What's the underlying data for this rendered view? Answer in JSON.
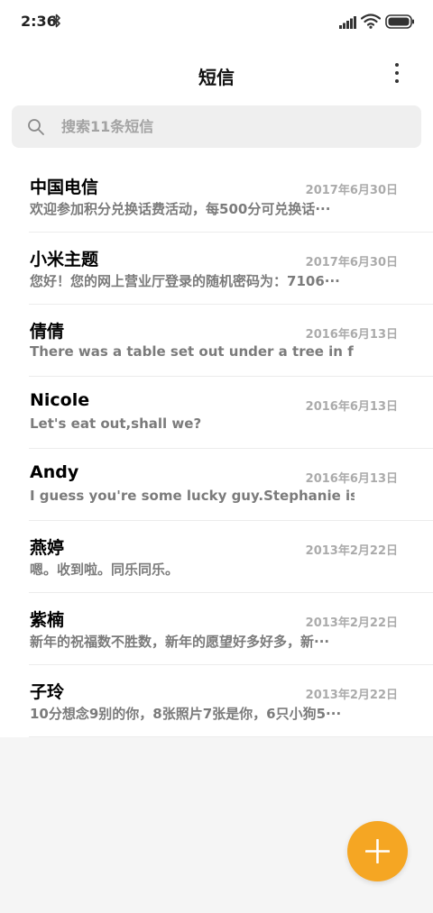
{
  "status_bar": {
    "time": "2:36",
    "icons": [
      "bluetooth-icon",
      "signal-icon",
      "wifi-icon",
      "battery-icon"
    ]
  },
  "header": {
    "title": "短信",
    "more_icon": "more-vertical-icon"
  },
  "search": {
    "placeholder": "搜索11条短信",
    "icon": "search-icon"
  },
  "conversations": [
    {
      "name": "中国电信",
      "date": "2017年6月30日",
      "preview": "欢迎参加积分兑换话费活动，每500分可兑换话···"
    },
    {
      "name": "小米主题",
      "date": "2017年6月30日",
      "preview": "您好！您的网上营业厅登录的随机密码为：7106···"
    },
    {
      "name": "倩倩",
      "date": "2016年6月13日",
      "preview": "There was a table set out under a tree in front of···"
    },
    {
      "name": "Nicole",
      "date": "2016年6月13日",
      "preview": "Let's eat out,shall we?"
    },
    {
      "name": "Andy",
      "date": "2016年6月13日",
      "preview": "I guess you're some lucky guy.Stephanie is a nic···"
    },
    {
      "name": "燕婷",
      "date": "2013年2月22日",
      "preview": "嗯。收到啦。同乐同乐。"
    },
    {
      "name": "紫楠",
      "date": "2013年2月22日",
      "preview": "新年的祝福数不胜数，新年的愿望好多好多，新···"
    },
    {
      "name": "子玲",
      "date": "2013年2月22日",
      "preview": "10分想念9别的你，8张照片7张是你，6只小狗5···"
    }
  ],
  "fab": {
    "icon": "plus-icon",
    "color": "#f5a623"
  },
  "colors": {
    "accent": "#f5a623",
    "background": "#f5f5f5",
    "list_background": "#ffffff"
  }
}
